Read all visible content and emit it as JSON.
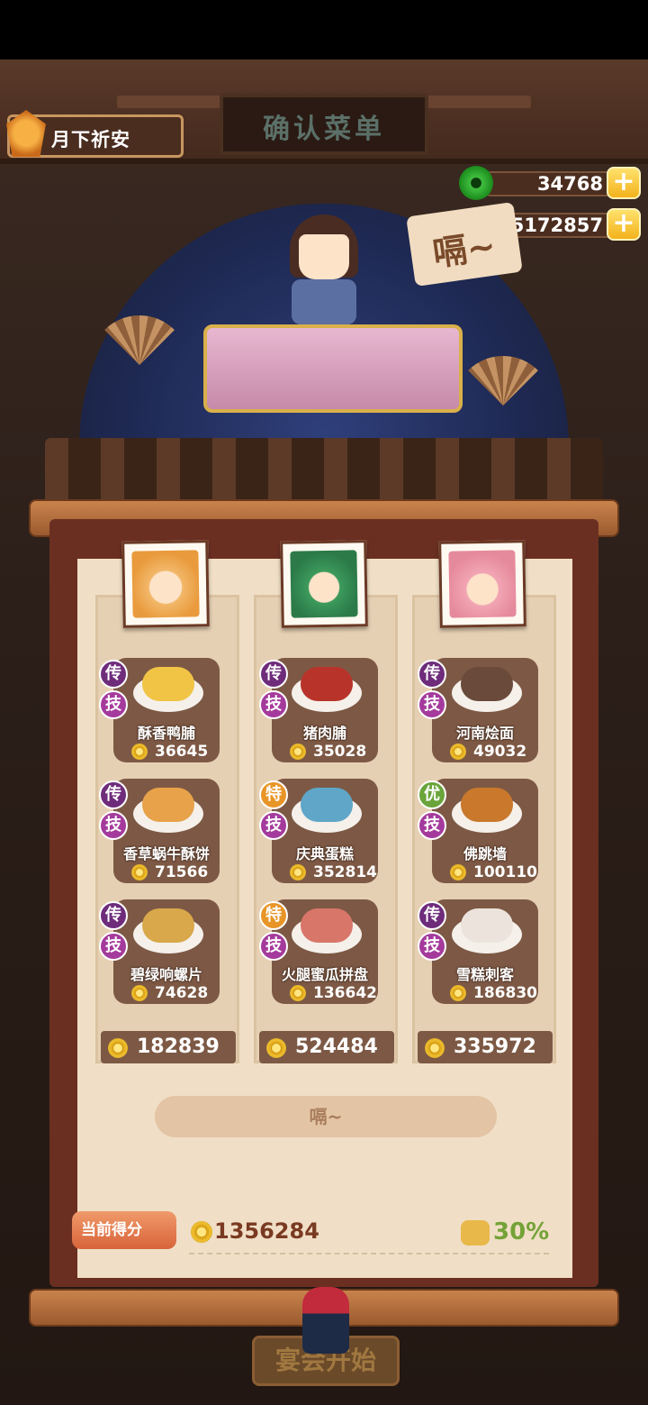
{
  "header": {
    "player_name": "月下祈安",
    "sign_text": "确认菜单",
    "jade_amount": "34768",
    "coin_amount": "5172857",
    "speech_text": "嗝~"
  },
  "columns": [
    {
      "total": "182839",
      "dishes": [
        {
          "badge1": "传",
          "badge2": "技",
          "name": "酥香鸭脯",
          "price": "36645"
        },
        {
          "badge1": "传",
          "badge2": "技",
          "name": "香草蜗牛酥饼",
          "price": "71566"
        },
        {
          "badge1": "传",
          "badge2": "技",
          "name": "碧绿响螺片",
          "price": "74628"
        }
      ]
    },
    {
      "total": "524484",
      "dishes": [
        {
          "badge1": "传",
          "badge2": "技",
          "name": "猪肉脯",
          "price": "35028"
        },
        {
          "badge1": "特",
          "badge2": "技",
          "name": "庆典蛋糕",
          "price": "352814"
        },
        {
          "badge1": "特",
          "badge2": "技",
          "name": "火腿蜜瓜拼盘",
          "price": "136642"
        }
      ]
    },
    {
      "total": "335972",
      "dishes": [
        {
          "badge1": "传",
          "badge2": "技",
          "name": "河南烩面",
          "price": "49032"
        },
        {
          "badge1": "优",
          "badge2": "技",
          "name": "佛跳墙",
          "price": "100110"
        },
        {
          "badge1": "传",
          "badge2": "技",
          "name": "雪糕刺客",
          "price": "186830"
        }
      ]
    }
  ],
  "main_button": "嗝~",
  "score": {
    "label": "当前得分",
    "value": "1356284",
    "bonus": "30%"
  },
  "start_button": "宴会开始",
  "colors": {
    "badge_chuan": "#6e2c7b",
    "badge_te": "#e89528",
    "badge_you": "#6aa43a",
    "badge_ji": "#a43b9c",
    "scroll_paper": "#f0dfc6",
    "dish_card": "#7d5945"
  }
}
